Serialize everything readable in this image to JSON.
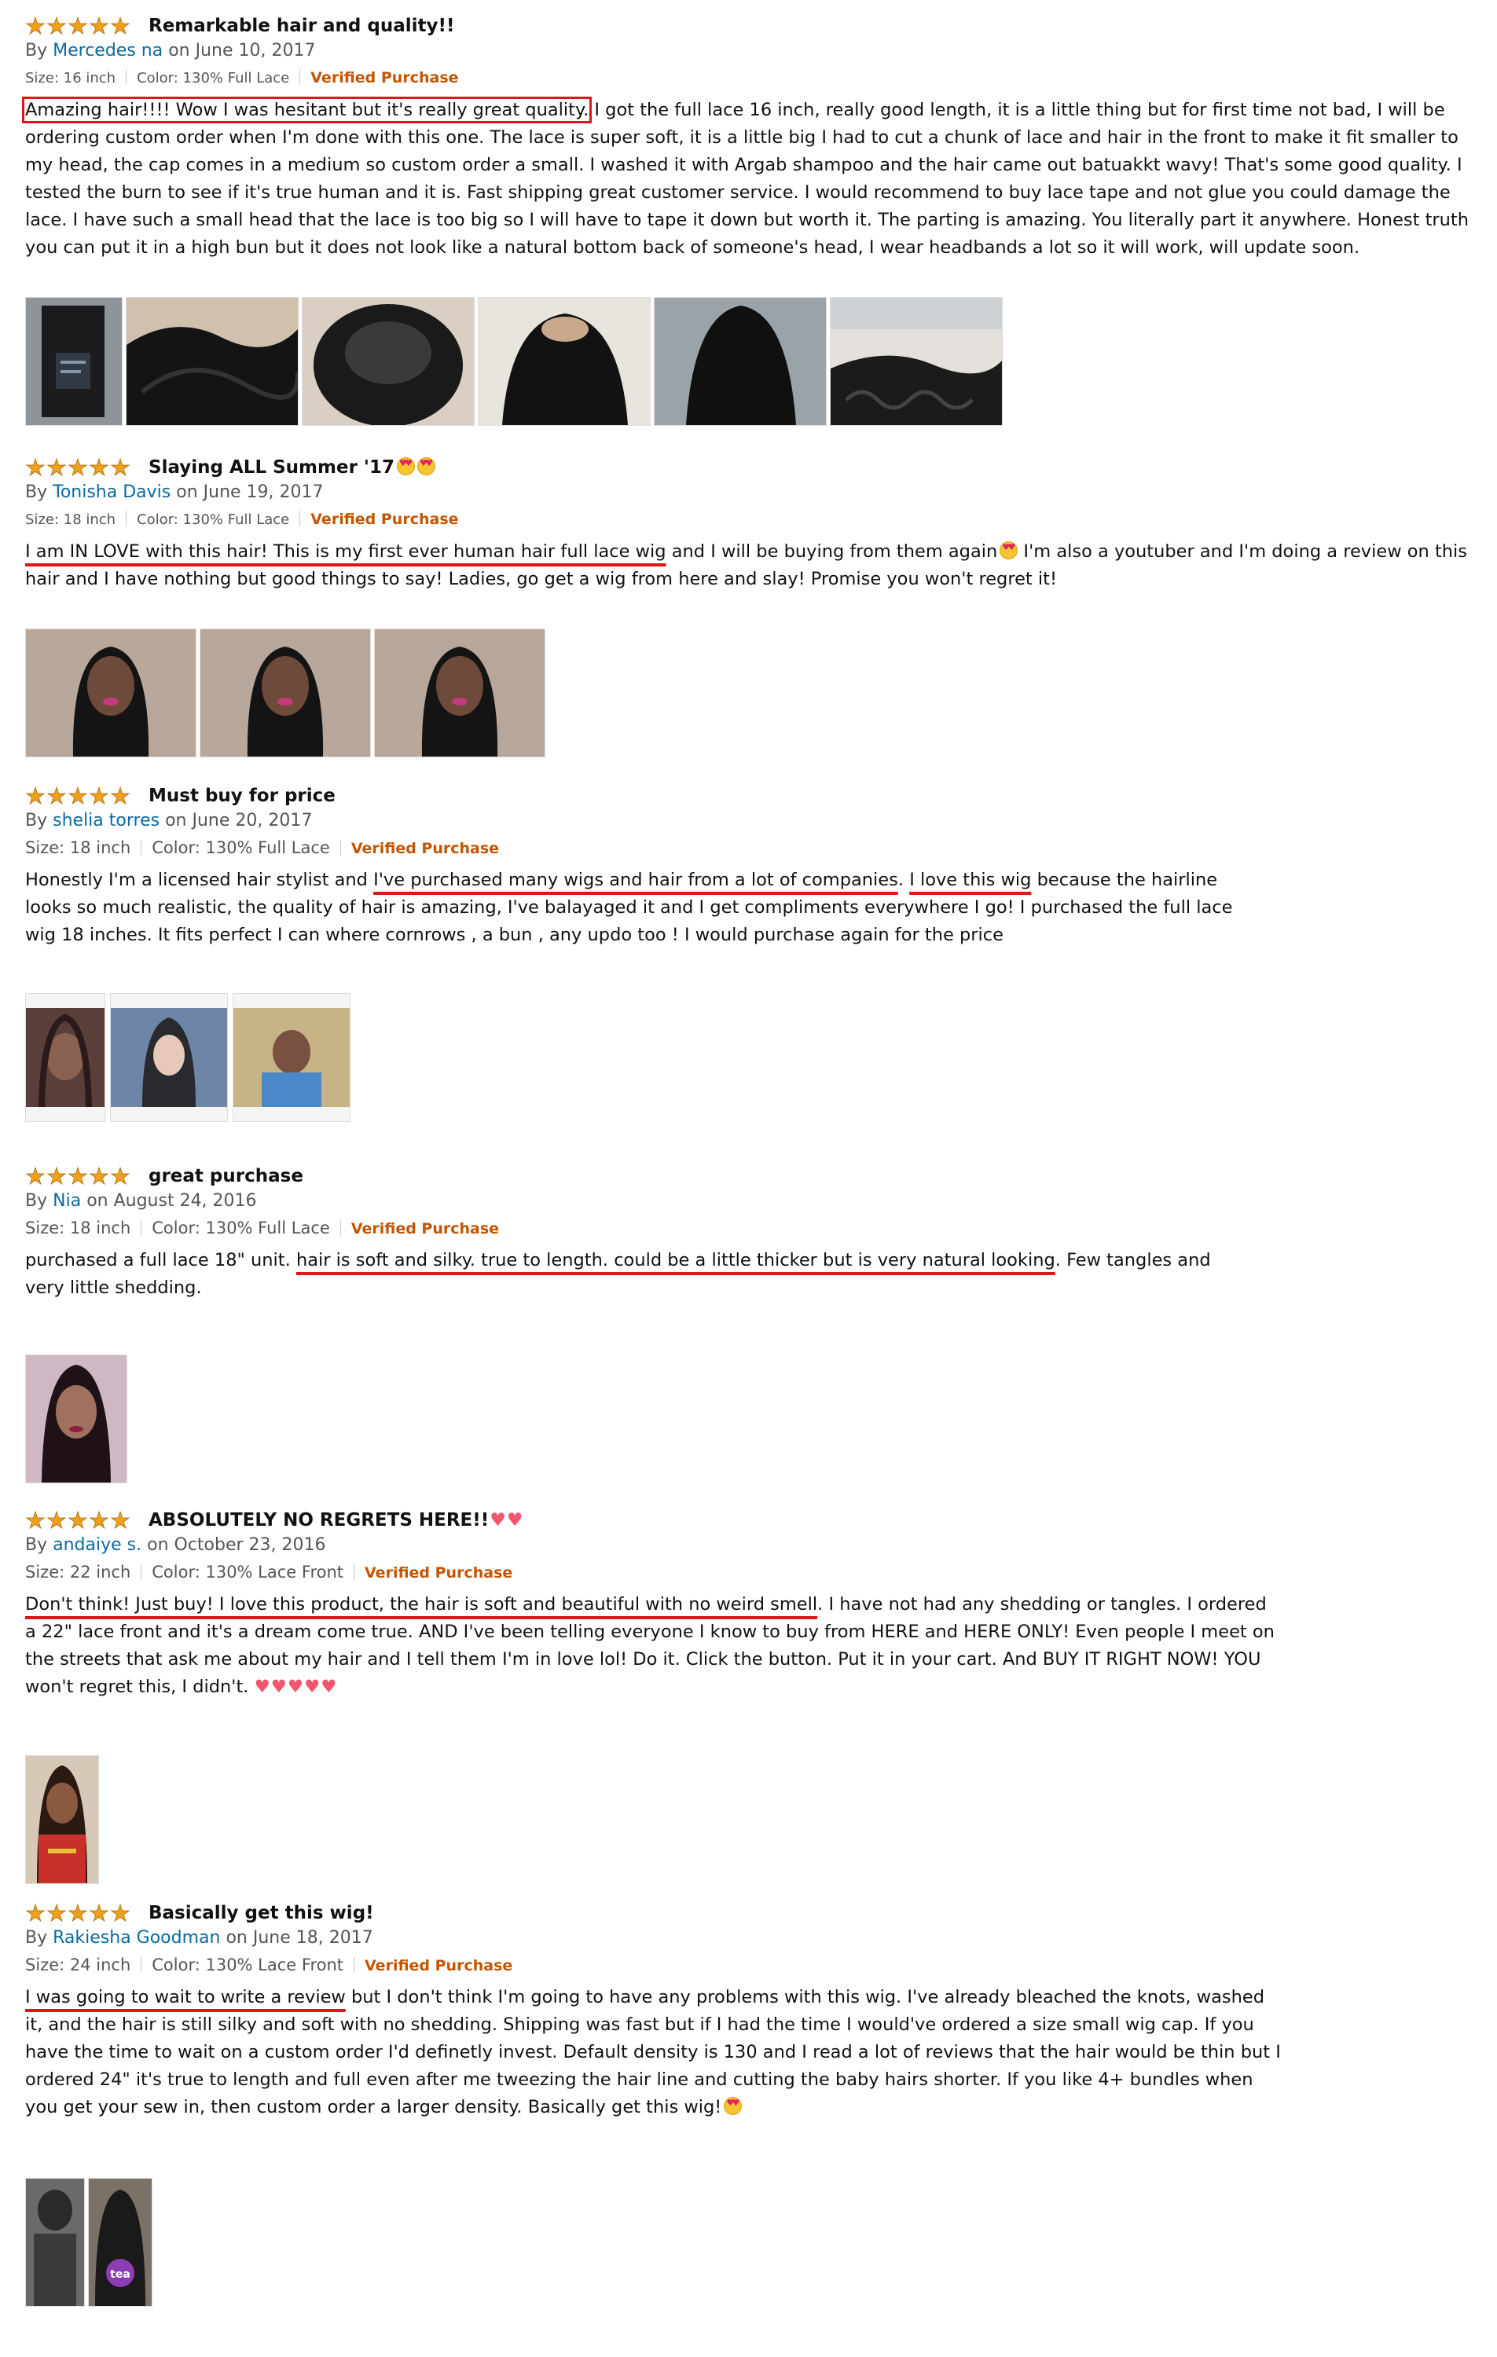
{
  "reviews": [
    {
      "stars": "★★★★★",
      "title": "Remarkable hair and quality!!",
      "by": "By",
      "author": "Mercedes na",
      "date": "on June 10, 2017",
      "size": "Size: 16 inch",
      "color": "Color: 130% Full Lace",
      "verified": "Verified Purchase",
      "text_a": "Amazing hair!!!! Wow I was hesitant but it's really great quality.",
      "text_b": " I got the full lace 16 inch, really good length, it is a little thing but for first time not bad, I will be ordering custom order when I'm done with this one. The lace is super soft, it is a little big I had to cut a chunk of lace and hair in the front to make it fit smaller to my head, the cap comes in a medium so custom order a small. I washed it with Argab shampoo and the hair came out batuakkt wavy! That's some good quality. I tested the burn to see if it's true human and it is. Fast shipping great customer service. I would recommend to buy lace tape and not glue you could damage the lace. I have such a small head that the lace is too big so I will have to tape it down but worth it. The parting is amazing. You literally part it anywhere. Honest truth you can put it in a high bun but it does not look like a natural bottom back of someone's head, I wear headbands a lot so it will work, will update soon."
    },
    {
      "stars": "★★★★★",
      "title": "Slaying ALL Summer '17",
      "by": "By",
      "author": "Tonisha Davis",
      "date": "on June 19, 2017",
      "size": "Size: 18 inch",
      "color": "Color: 130% Full Lace",
      "verified": "Verified Purchase",
      "text_a": "I am IN LOVE with this hair! This is my first ever human hair full lace wig",
      "text_b": " and I will be buying from them again",
      "text_c": " I'm also a youtuber and I'm doing a review on this hair and I have nothing but good things to say! Ladies, go get a wig from here and slay! Promise you won't regret it!"
    },
    {
      "stars": "★★★★★",
      "title": "Must buy for price",
      "by": "By",
      "author": "shelia torres",
      "date": "on June 20, 2017",
      "size": "Size: 18 inch",
      "color": "Color: 130% Full Lace",
      "verified": "Verified Purchase",
      "text_a": "Honestly I'm a licensed hair stylist and ",
      "text_b": "I've purchased many wigs and hair from a lot of companies",
      "text_c": ". ",
      "text_d": "I love this wig",
      "text_e": " because the hairline looks so much realistic, the quality of hair is amazing, I've balayaged it and I get compliments everywhere I go! I purchased the full lace wig 18 inches. It fits perfect I can where cornrows , a bun , any updo too ! I would purchase again for the price"
    },
    {
      "stars": "★★★★★",
      "title": "great purchase",
      "by": "By",
      "author": "Nia",
      "date": "on August 24, 2016",
      "size": "Size: 18 inch",
      "color": "Color: 130% Full Lace",
      "verified": "Verified Purchase",
      "text_a": "purchased a full lace 18\" unit. ",
      "text_b": "hair is soft and silky. true to length. could be a little thicker but is very natural looking",
      "text_c": ". Few tangles and very little shedding."
    },
    {
      "stars": "★★★★★",
      "title": "ABSOLUTELY NO REGRETS HERE!!",
      "by": "By",
      "author": "andaiye s.",
      "date": "on October 23, 2016",
      "size": "Size: 22 inch",
      "color": "Color: 130% Lace Front",
      "verified": "Verified Purchase",
      "text_a": "Don't think! Just buy! I love this product, the hair is soft and beautiful with no weird smell",
      "text_b": ". I have not had any shedding or tangles. I ordered a 22\" lace front and it's a dream come true. AND I've been telling everyone I know to buy from HERE and HERE ONLY! Even people I meet on the streets that ask me about my hair and I tell them I'm in love lol! Do it. Click the button. Put it in your cart. And BUY IT RIGHT NOW! YOU won't regret this, I didn't.",
      "hearts": "♥♥♥♥♥"
    },
    {
      "stars": "★★★★★",
      "title": "Basically get this wig!",
      "by": "By",
      "author": "Rakiesha Goodman",
      "date": "on June 18, 2017",
      "size": "Size: 24 inch",
      "color": "Color: 130% Lace Front",
      "verified": "Verified Purchase",
      "text_a": "I was going to wait to write a review",
      "text_b": " but I don't think I'm going to have any problems with this wig. I've already bleached the knots, washed it, and the hair is still silky and soft with no shedding. Shipping was fast but if I had the time I would've ordered a size small wig cap. If you have the time to wait on a custom order I'd definetly invest. Default density is 130 and I read a lot of reviews that the hair would be thin but I ordered 24\" it's true to length and full even after me tweezing the hair line and cutting the baby hairs shorter. If you like 4+ bundles when you get your sew in, then custom order a larger density. Basically get this wig!"
    }
  ],
  "photo_label": "tea"
}
